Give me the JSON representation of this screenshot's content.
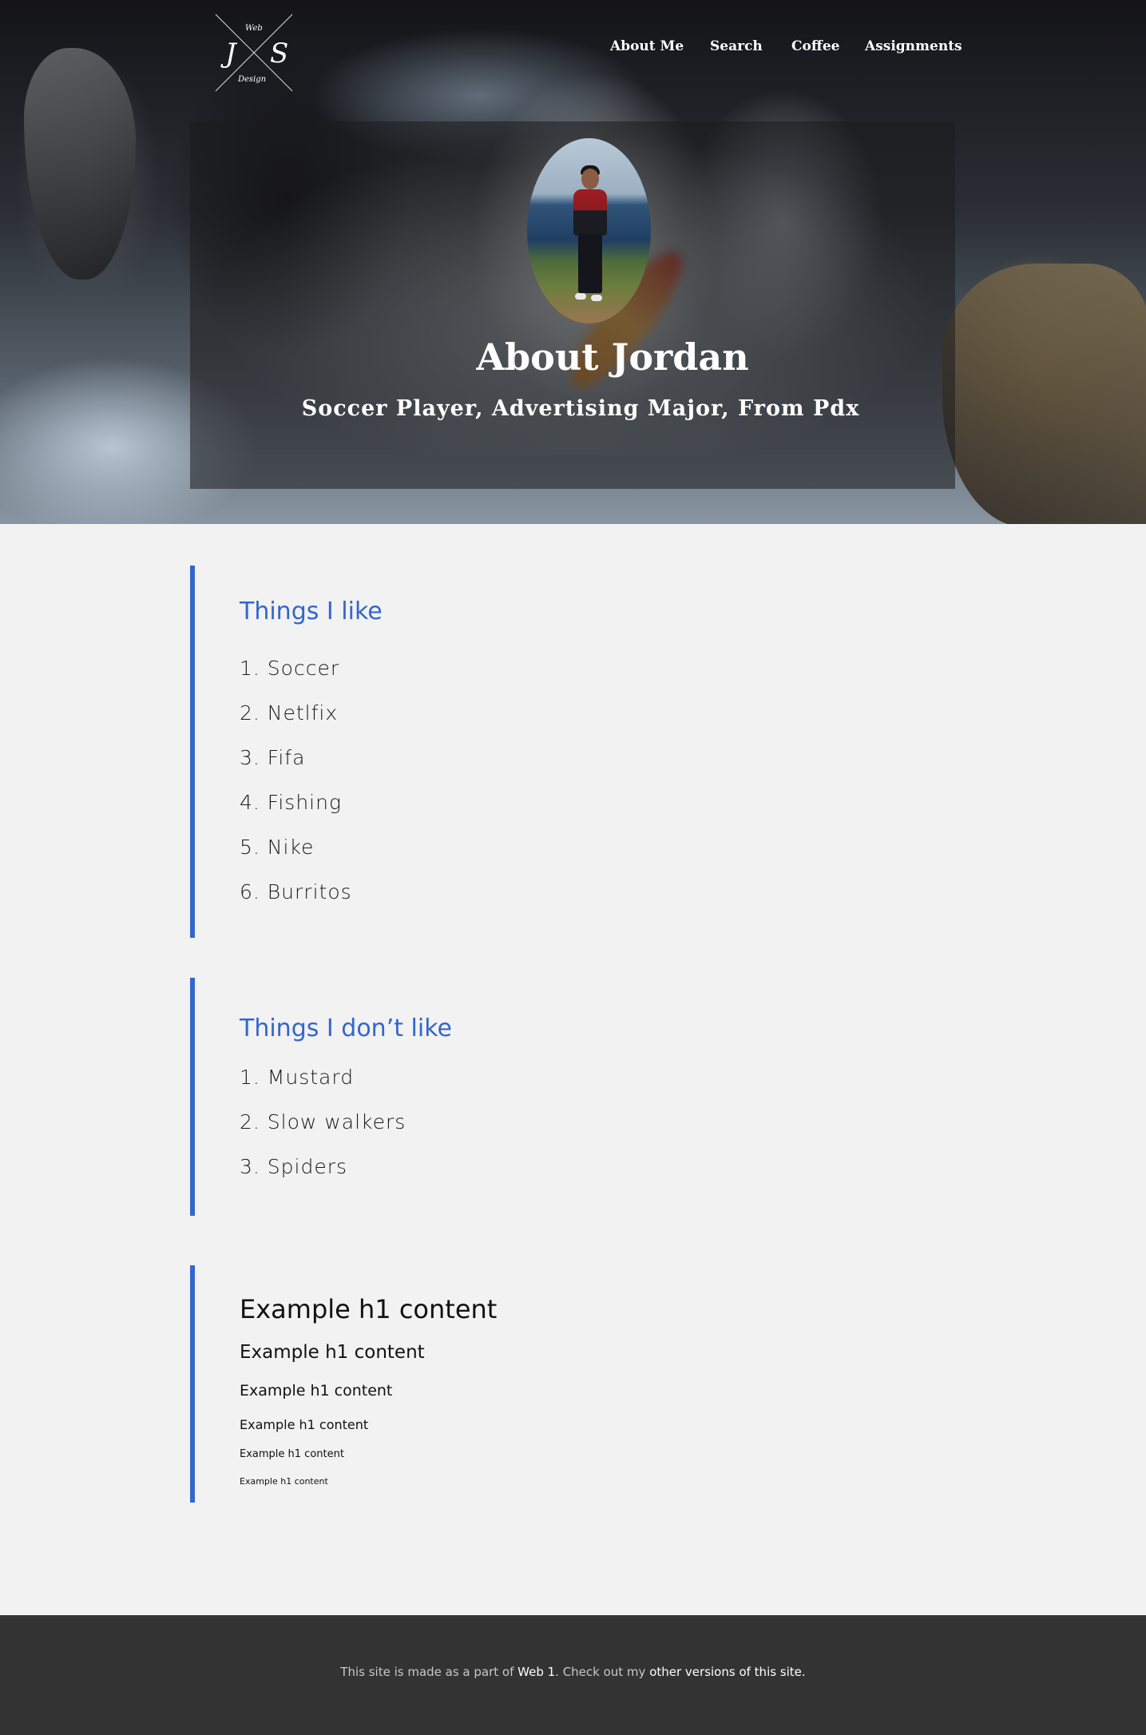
{
  "logo": {
    "initial_left": "J",
    "initial_right": "S",
    "word_top": "Web",
    "word_bottom": "Design"
  },
  "nav": {
    "items": [
      "About Me",
      "Search",
      "Coffee",
      "Assignments"
    ]
  },
  "hero": {
    "title": "About Jordan",
    "subtitle": "Soccer Player, Advertising Major, From Pdx"
  },
  "likes": {
    "heading": "Things I like",
    "items": [
      "1. Soccer",
      "2. Netlfix",
      "3. Fifa",
      "4. Fishing",
      "5. Nike",
      "6. Burritos"
    ]
  },
  "dislikes": {
    "heading": "Things I don’t like",
    "items": [
      "1. Mustard",
      "2. Slow walkers",
      "3. Spiders"
    ]
  },
  "examples": {
    "h1": "Example h1 content",
    "h2": "Example h1 content",
    "h3": "Example h1 content",
    "h4": "Example h1 content",
    "h5": "Example h1 content",
    "h6": "Example h1 content"
  },
  "footer": {
    "text_before": "This site is made as a part of ",
    "link_web1": "Web 1",
    "text_middle": ". Check out my ",
    "link_versions": "other versions of this site."
  },
  "colors": {
    "accent": "#3366cc",
    "footer_bg": "#333333",
    "page_bg": "#f2f2f2"
  }
}
